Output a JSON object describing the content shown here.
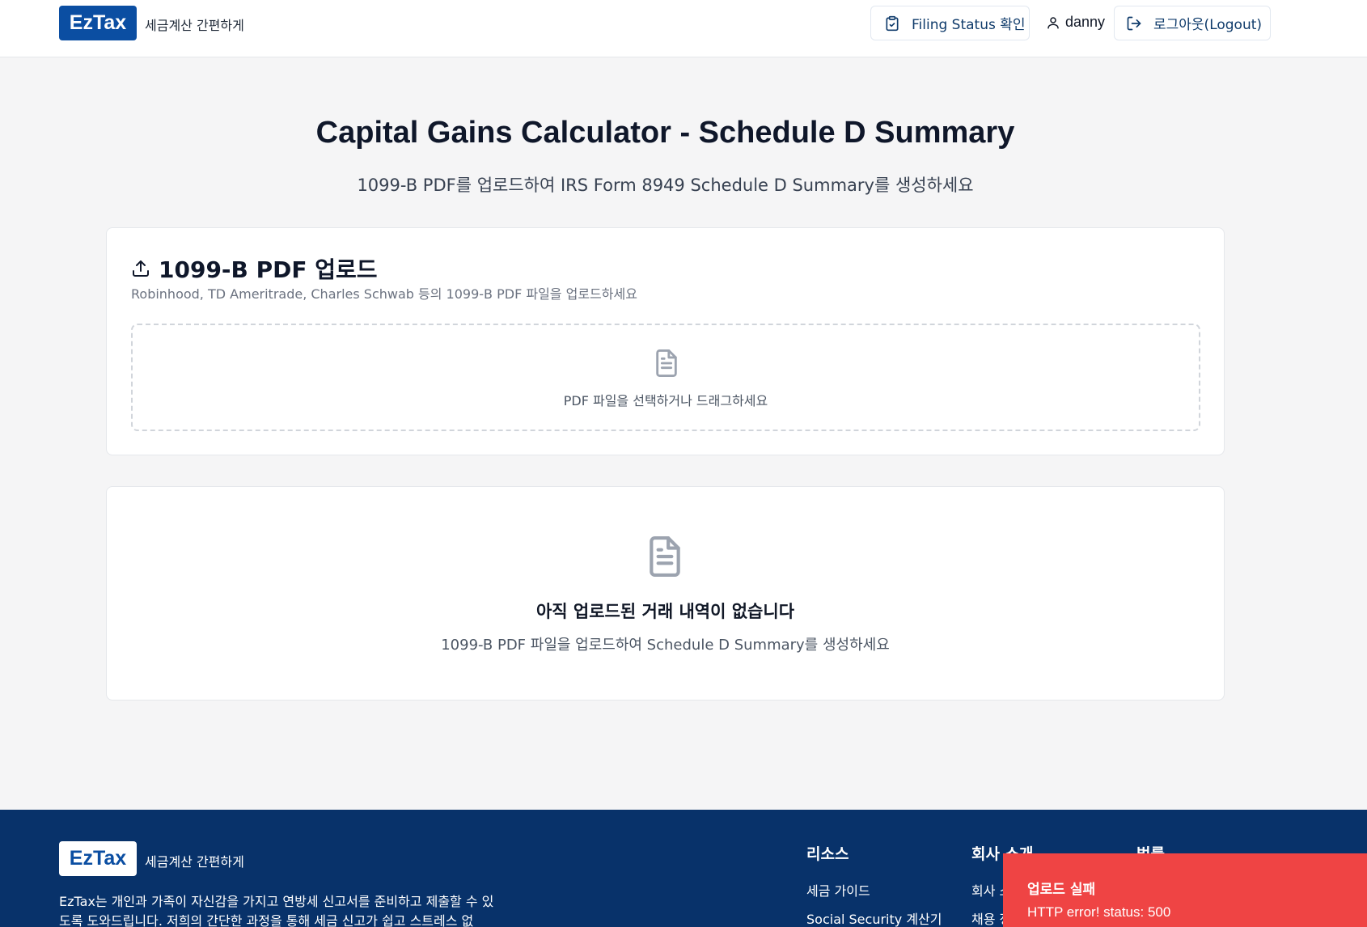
{
  "header": {
    "logo": "EzTax",
    "tagline": "세금계산 간편하게",
    "filing_status_label": "Filing Status 확인",
    "username": "danny",
    "logout_label": "로그아웃(Logout)"
  },
  "main": {
    "title": "Capital Gains Calculator - Schedule D Summary",
    "subtitle": "1099-B PDF를 업로드하여 IRS Form 8949 Schedule D Summary를 생성하세요",
    "upload_card": {
      "title": "1099-B PDF 업로드",
      "description": "Robinhood, TD Ameritrade, Charles Schwab 등의 1099-B PDF 파일을 업로드하세요",
      "dropzone_text": "PDF 파일을 선택하거나 드래그하세요"
    },
    "empty_card": {
      "title": "아직 업로드된 거래 내역이 없습니다",
      "description": "1099-B PDF 파일을 업로드하여 Schedule D Summary를 생성하세요"
    }
  },
  "footer": {
    "logo": "EzTax",
    "tagline": "세금계산 간편하게",
    "description": "EzTax는 개인과 가족이 자신감을 가지고 연방세 신고서를 준비하고 제출할 수 있도록 도와드립니다. 저희의 간단한 과정을 통해 세금 신고가 쉽고 스트레스 없",
    "columns": [
      {
        "title": "리소스",
        "links": [
          "세금 가이드",
          "Social Security 계산기"
        ]
      },
      {
        "title": "회사 소개",
        "links": [
          "회사 소개",
          "채용 정보"
        ]
      },
      {
        "title": "법률",
        "links": []
      }
    ]
  },
  "toast": {
    "title": "업로드 실패",
    "message": "HTTP error! status: 500"
  },
  "colors": {
    "brand": "#0b4ea2",
    "footer_bg": "#08326a",
    "toast_bg": "#ef4444"
  }
}
